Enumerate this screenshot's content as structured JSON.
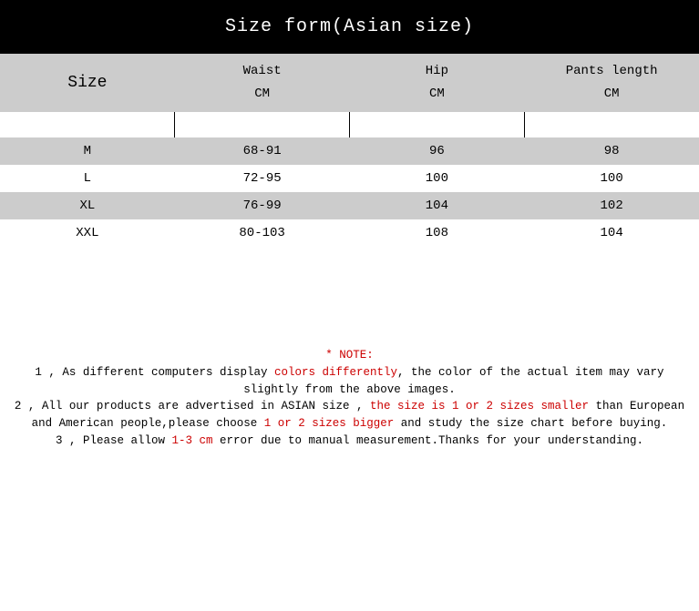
{
  "title": "Size form(Asian size)",
  "headers": {
    "size": "Size",
    "waist": "Waist",
    "hip": "Hip",
    "pants_length": "Pants length",
    "unit": "CM"
  },
  "chart_data": {
    "type": "table",
    "title": "Size form(Asian size)",
    "columns": [
      "Size",
      "Waist (CM)",
      "Hip (CM)",
      "Pants length (CM)"
    ],
    "rows": [
      {
        "size": "M",
        "waist": "68-91",
        "hip": "96",
        "pants_length": "98"
      },
      {
        "size": "L",
        "waist": "72-95",
        "hip": "100",
        "pants_length": "100"
      },
      {
        "size": "XL",
        "waist": "76-99",
        "hip": "104",
        "pants_length": "102"
      },
      {
        "size": "XXL",
        "waist": "80-103",
        "hip": "108",
        "pants_length": "104"
      }
    ]
  },
  "notes": {
    "heading": "* NOTE:",
    "n1_a": "1 , As different computers display ",
    "n1_b": "colors differently",
    "n1_c": ", the color of the actual item may vary slightly from the above images.",
    "n2_a": "2 , All our products are advertised in ASIAN size , ",
    "n2_b": "the size is 1 or 2 sizes smaller",
    "n2_c": " than European and American people,please choose ",
    "n2_d": "1 or 2 sizes bigger",
    "n2_e": " and study the size chart before buying.",
    "n3_a": "3 , Please allow ",
    "n3_b": "1-3 cm",
    "n3_c": " error due to manual measurement.Thanks for your understanding."
  }
}
